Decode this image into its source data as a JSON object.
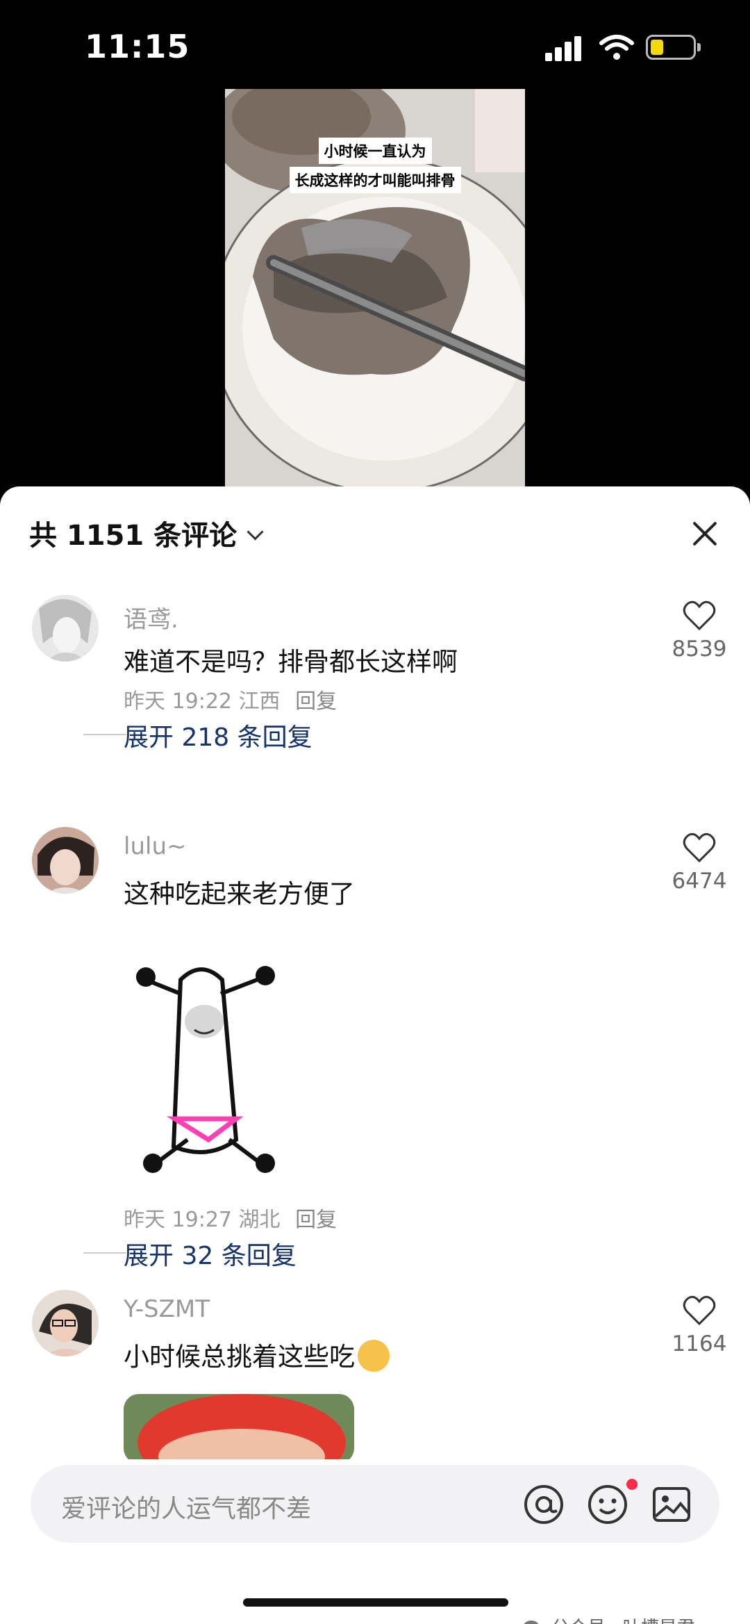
{
  "status_bar": {
    "time": "11:15"
  },
  "video": {
    "caption_line1": "小时候一直认为",
    "caption_line2": "长成这样的才叫能叫排骨"
  },
  "sheet": {
    "title": "共 1151 条评论"
  },
  "comments": [
    {
      "username": "语鸢.",
      "text": "难道不是吗？排骨都长这样啊",
      "time": "昨天 19:22",
      "location": "江西",
      "reply_label": "回复",
      "likes": "8539",
      "expand_label": "展开 218 条回复"
    },
    {
      "username": "lulu~",
      "text": "这种吃起来老方便了",
      "time": "昨天 19:27",
      "location": "湖北",
      "reply_label": "回复",
      "likes": "6474",
      "expand_label": "展开 32 条回复"
    },
    {
      "username": "Y-SZMT",
      "text": "小时候总挑着这些吃",
      "likes": "1164"
    }
  ],
  "input": {
    "placeholder": "爱评论的人运气都不差"
  },
  "watermark": {
    "text": "公众号 · 吐槽星君"
  },
  "colors": {
    "accent_blue": "#15326b",
    "notify_red": "#fa2c48",
    "battery": "#f5d90a"
  }
}
